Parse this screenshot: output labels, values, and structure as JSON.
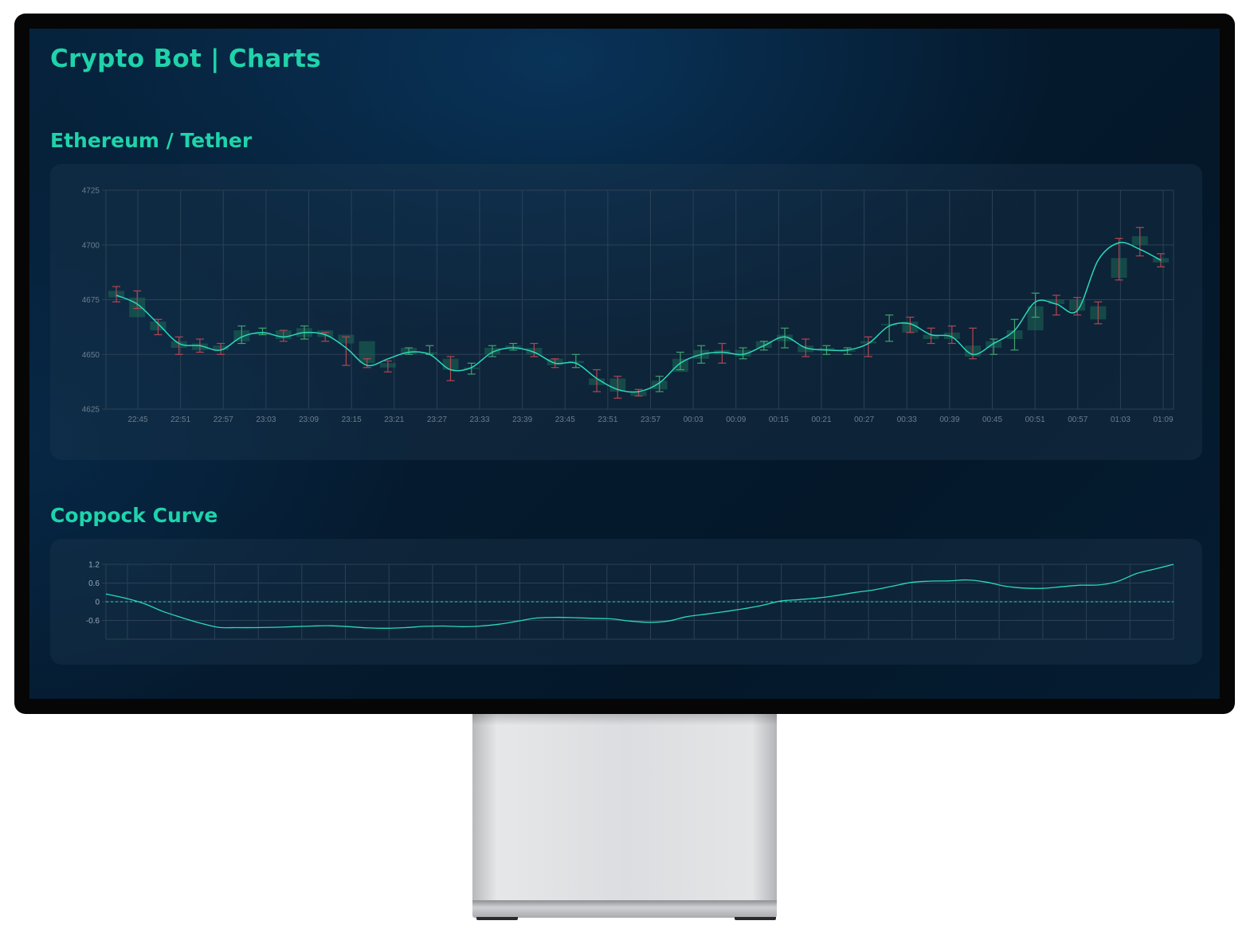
{
  "app": {
    "title": "Crypto Bot | Charts"
  },
  "sections": {
    "price_title": "Ethereum / Tether",
    "indicator_title": "Coppock Curve"
  },
  "colors": {
    "accent": "#1fd3aa",
    "up": "#3fa36d",
    "down": "#b3464f",
    "line": "#2ad9bb",
    "grid": "#2c4155",
    "tick_text": "#6c7d8e"
  },
  "chart_data": [
    {
      "type": "candlestick",
      "title": "Ethereum / Tether",
      "ylim": [
        4625,
        4725
      ],
      "yticks": [
        4625,
        4650,
        4675,
        4700,
        4725
      ],
      "xticks": [
        "22:45",
        "22:51",
        "22:57",
        "23:03",
        "23:09",
        "23:15",
        "23:21",
        "23:27",
        "23:33",
        "23:39",
        "23:45",
        "23:51",
        "23:57",
        "00:03",
        "00:09",
        "00:15",
        "00:21",
        "00:27",
        "00:33",
        "00:39",
        "00:45",
        "00:51",
        "00:57",
        "01:03",
        "01:09"
      ],
      "series": [
        {
          "type": "candles",
          "open": [
            4679,
            4676,
            4665,
            4656,
            4655,
            4654,
            4656,
            4659,
            4661,
            4658,
            4661,
            4659,
            4656,
            4646,
            4650,
            4651,
            4648,
            4644,
            4650,
            4653,
            4653,
            4648,
            4646,
            4639,
            4639,
            4633,
            4634,
            4642,
            4648,
            4652,
            4649,
            4653,
            4656,
            4654,
            4652,
            4652,
            4656,
            4664,
            4665,
            4659,
            4660,
            4654,
            4653,
            4657,
            4661,
            4675,
            4675,
            4672,
            4694,
            4704,
            4694
          ],
          "close": [
            4676,
            4667,
            4661,
            4653,
            4652,
            4652,
            4661,
            4660,
            4657,
            4662,
            4658,
            4655,
            4646,
            4644,
            4653,
            4651,
            4643,
            4644,
            4653,
            4654,
            4650,
            4645,
            4647,
            4636,
            4633,
            4631,
            4638,
            4648,
            4652,
            4650,
            4652,
            4656,
            4659,
            4651,
            4653,
            4652,
            4655,
            4664,
            4660,
            4657,
            4657,
            4649,
            4656,
            4661,
            4672,
            4673,
            4670,
            4666,
            4685,
            4700,
            4692
          ],
          "high": [
            4681,
            4679,
            4666,
            4658,
            4657,
            4655,
            4663,
            4662,
            4661,
            4663,
            4660,
            4658,
            4648,
            4647,
            4653,
            4654,
            4649,
            4646,
            4654,
            4655,
            4655,
            4648,
            4650,
            4643,
            4640,
            4634,
            4640,
            4651,
            4654,
            4655,
            4653,
            4656,
            4662,
            4657,
            4654,
            4653,
            4658,
            4668,
            4667,
            4662,
            4663,
            4662,
            4657,
            4666,
            4678,
            4677,
            4676,
            4674,
            4703,
            4708,
            4696
          ],
          "low": [
            4674,
            4671,
            4659,
            4650,
            4651,
            4650,
            4655,
            4659,
            4656,
            4657,
            4656,
            4645,
            4644,
            4642,
            4650,
            4650,
            4638,
            4641,
            4649,
            4652,
            4649,
            4644,
            4644,
            4633,
            4630,
            4631,
            4633,
            4643,
            4646,
            4646,
            4648,
            4652,
            4653,
            4649,
            4650,
            4650,
            4649,
            4656,
            4660,
            4655,
            4655,
            4648,
            4650,
            4652,
            4667,
            4668,
            4668,
            4664,
            4684,
            4695,
            4690
          ]
        },
        {
          "type": "line",
          "values": [
            4677,
            4673,
            4664,
            4655,
            4654,
            4652,
            4658,
            4660,
            4658,
            4660,
            4659,
            4653,
            4645,
            4648,
            4651,
            4650,
            4643,
            4644,
            4651,
            4653,
            4651,
            4646,
            4646,
            4639,
            4634,
            4633,
            4637,
            4646,
            4650,
            4651,
            4650,
            4654,
            4658,
            4653,
            4652,
            4652,
            4655,
            4663,
            4664,
            4659,
            4658,
            4650,
            4655,
            4661,
            4674,
            4673,
            4670,
            4693,
            4701,
            4698,
            4693
          ]
        }
      ]
    },
    {
      "type": "line",
      "title": "Coppock Curve",
      "ylim": [
        -1.2,
        1.2
      ],
      "yticks": [
        "1.2",
        "0.6",
        "0",
        "-0.6"
      ],
      "reference_line": 0,
      "values": [
        0.25,
        0.12,
        -0.05,
        -0.3,
        -0.5,
        -0.68,
        -0.82,
        -0.83,
        -0.83,
        -0.82,
        -0.8,
        -0.78,
        -0.77,
        -0.8,
        -0.84,
        -0.85,
        -0.83,
        -0.79,
        -0.78,
        -0.8,
        -0.78,
        -0.72,
        -0.62,
        -0.52,
        -0.5,
        -0.51,
        -0.53,
        -0.55,
        -0.62,
        -0.66,
        -0.62,
        -0.48,
        -0.4,
        -0.32,
        -0.23,
        -0.12,
        0.02,
        0.07,
        0.12,
        0.2,
        0.3,
        0.38,
        0.5,
        0.62,
        0.66,
        0.67,
        0.7,
        0.63,
        0.5,
        0.44,
        0.43,
        0.48,
        0.53,
        0.54,
        0.65,
        0.9,
        1.05,
        1.2
      ]
    }
  ]
}
